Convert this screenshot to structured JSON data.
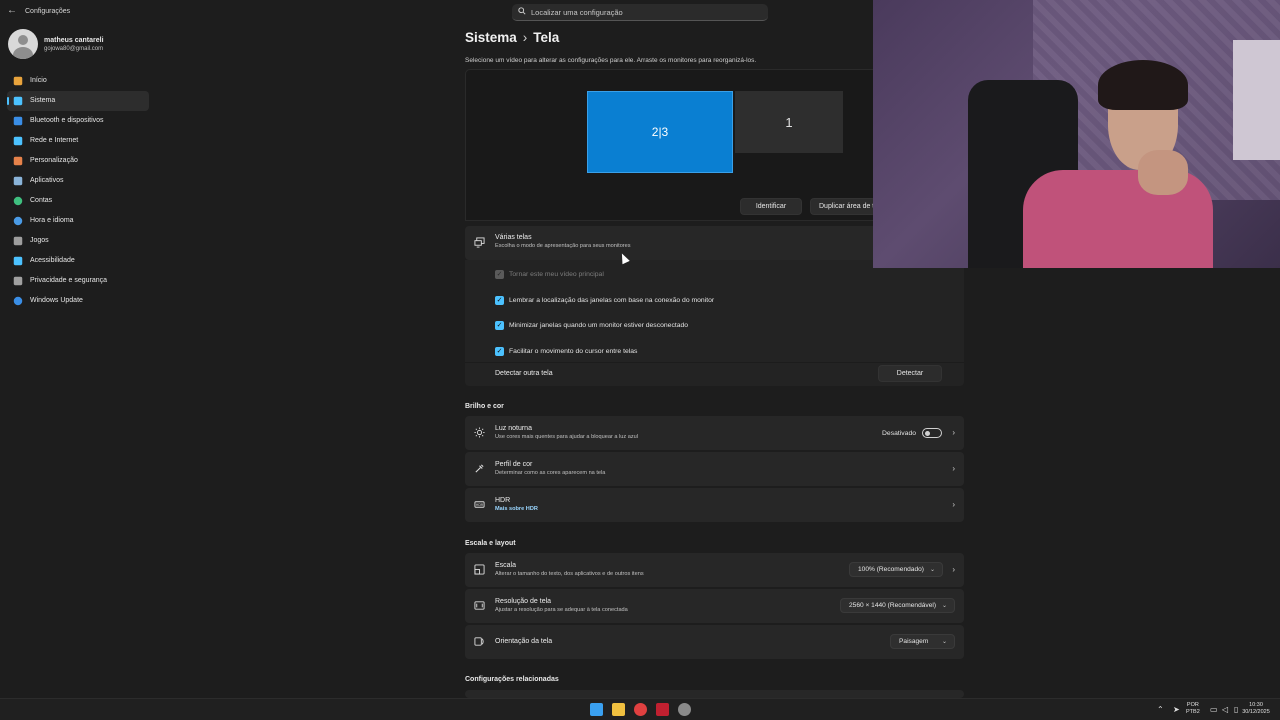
{
  "window": {
    "title": "Configurações",
    "back_glyph": "←"
  },
  "search": {
    "placeholder": "Localizar uma configuração"
  },
  "profile": {
    "name": "matheus cantareli",
    "email": "gojowa80@gmail.com"
  },
  "sidebar": {
    "items": [
      {
        "label": "Início",
        "icon": "home-icon",
        "color": "#e8a33c"
      },
      {
        "label": "Sistema",
        "icon": "system-icon",
        "color": "#4cc2ff",
        "active": true
      },
      {
        "label": "Bluetooth e dispositivos",
        "icon": "bluetooth-icon",
        "color": "#3a8ee6"
      },
      {
        "label": "Rede e Internet",
        "icon": "wifi-icon",
        "color": "#4cc2ff"
      },
      {
        "label": "Personalização",
        "icon": "brush-icon",
        "color": "#e6824a"
      },
      {
        "label": "Aplicativos",
        "icon": "apps-icon",
        "color": "#8ab4d9"
      },
      {
        "label": "Contas",
        "icon": "account-icon",
        "color": "#3fbf7f"
      },
      {
        "label": "Hora e idioma",
        "icon": "globe-clock-icon",
        "color": "#4a9be6"
      },
      {
        "label": "Jogos",
        "icon": "gamepad-icon",
        "color": "#9e9e9e"
      },
      {
        "label": "Acessibilidade",
        "icon": "accessibility-icon",
        "color": "#4cc2ff"
      },
      {
        "label": "Privacidade e segurança",
        "icon": "shield-icon",
        "color": "#a0a0a0"
      },
      {
        "label": "Windows Update",
        "icon": "update-icon",
        "color": "#3a8ee6"
      }
    ]
  },
  "breadcrumb": {
    "parent": "Sistema",
    "separator": "›",
    "current": "Tela"
  },
  "display": {
    "hint": "Selecione um vídeo para alterar as configurações para ele. Arraste os monitores para reorganizá-los.",
    "monitor_selected": "2|3",
    "monitor_other": "1",
    "identify_label": "Identificar",
    "duplicate_label": "Duplicar área de t"
  },
  "multi": {
    "title": "Várias telas",
    "subtitle": "Escolha o modo de apresentação para seus monitores",
    "options": [
      {
        "label": "Tornar este meu vídeo principal",
        "checked": true,
        "disabled": true
      },
      {
        "label": "Lembrar a localização das janelas com base na conexão do monitor",
        "checked": true,
        "disabled": false
      },
      {
        "label": "Minimizar janelas quando um monitor estiver desconectado",
        "checked": true,
        "disabled": false
      },
      {
        "label": "Facilitar o movimento do cursor entre telas",
        "checked": true,
        "disabled": false
      }
    ],
    "detect_text": "Detectar outra tela",
    "detect_button": "Detectar"
  },
  "brightness": {
    "heading": "Brilho e cor",
    "night_title": "Luz noturna",
    "night_sub": "Use cores mais quentes para ajudar a bloquear a luz azul",
    "night_state": "Desativado",
    "night_on": false,
    "profile_title": "Perfil de cor",
    "profile_sub": "Determinar como as cores aparecem na tela",
    "hdr_title": "HDR",
    "hdr_link": "Mais sobre HDR"
  },
  "scale": {
    "heading": "Escala e layout",
    "scale_title": "Escala",
    "scale_sub": "Alterar o tamanho do texto, dos aplicativos e de outros itens",
    "scale_value": "100% (Recomendado)",
    "res_title": "Resolução de tela",
    "res_sub": "Ajustar a resolução para se adequar à tela conectada",
    "res_value": "2560 × 1440 (Recomendável)",
    "orient_title": "Orientação da tela",
    "orient_value": "Paisagem"
  },
  "related": {
    "heading": "Configurações relacionadas"
  },
  "taskbar": {
    "lang_top": "POR",
    "lang_bottom": "PTB2",
    "time": "10:30",
    "date": "30/12/2025",
    "apps": [
      "start-icon",
      "explorer-icon",
      "chrome-icon",
      "app-red-icon",
      "settings-icon"
    ]
  },
  "colors": {
    "accent": "#4cc2ff",
    "monitor_selected": "#0a7fd2"
  }
}
